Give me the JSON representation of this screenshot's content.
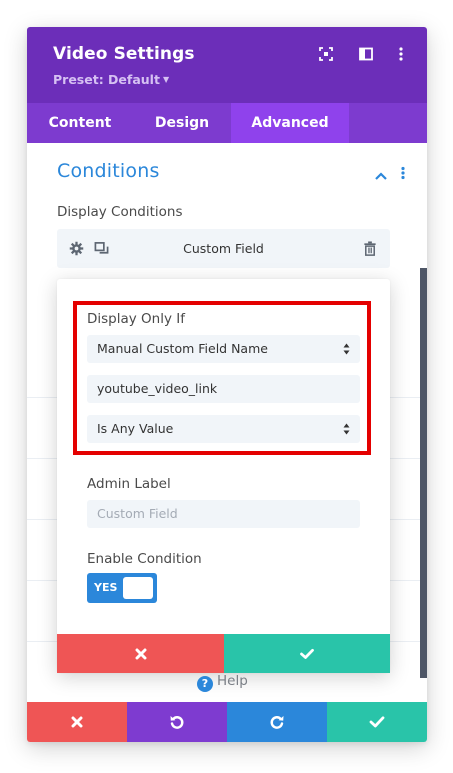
{
  "header": {
    "title": "Video Settings",
    "preset": "Preset: Default",
    "icons": [
      "expand-icon",
      "sidebar-layout-icon",
      "more-vertical-icon"
    ]
  },
  "tabs": [
    {
      "label": "Content",
      "active": false
    },
    {
      "label": "Design",
      "active": false
    },
    {
      "label": "Advanced",
      "active": true
    }
  ],
  "section": {
    "title": "Conditions",
    "display_conditions_label": "Display Conditions",
    "condition_name": "Custom Field"
  },
  "popup": {
    "display_only_if_label": "Display Only If",
    "field_type_select": "Manual Custom Field Name",
    "field_name_value": "youtube_video_link",
    "comparison_select": "Is Any Value",
    "admin_label_label": "Admin Label",
    "admin_label_placeholder": "Custom Field",
    "enable_condition_label": "Enable Condition",
    "toggle_text": "YES",
    "toggle_on": true
  },
  "help": {
    "label": "Help"
  },
  "colors": {
    "header_bg": "#6c2eb9",
    "tabs_bg": "#7d3bcf",
    "tab_active_bg": "#8f42ec",
    "accent_blue": "#2b87da",
    "cancel_red": "#ef5555",
    "confirm_green": "#29c4a9",
    "footer_purple": "#7e3bd0",
    "highlight_red": "#e40000"
  }
}
